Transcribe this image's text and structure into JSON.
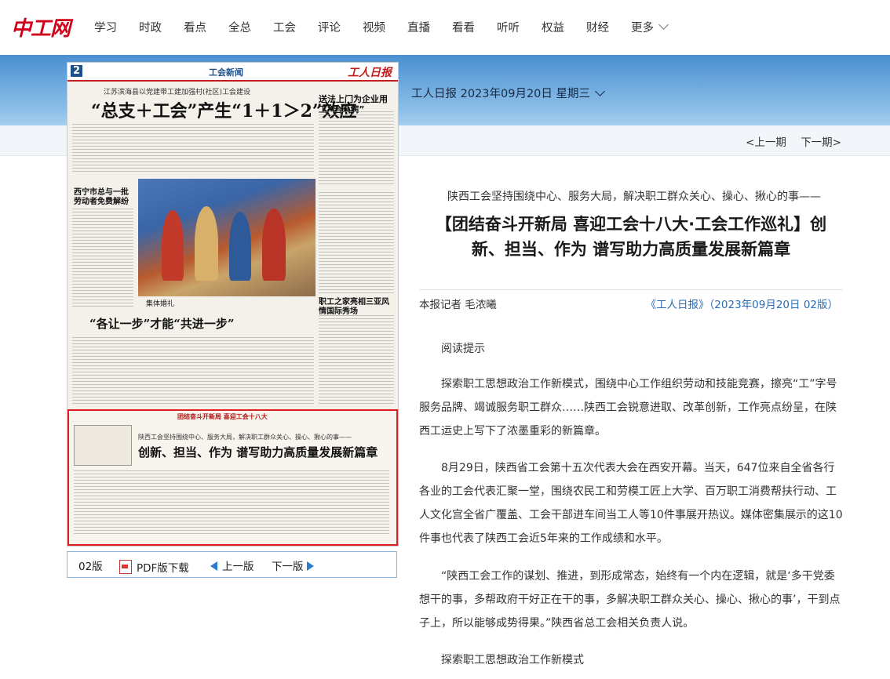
{
  "nav": {
    "logo": "中工网",
    "items": [
      "学习",
      "时政",
      "看点",
      "全总",
      "工会",
      "评论",
      "视频",
      "直播",
      "看看",
      "听听",
      "权益",
      "财经",
      "更多"
    ]
  },
  "edition": {
    "label": "工人日报 2023年09月20日 星期三"
  },
  "periods": {
    "prev": "<上一期",
    "next": "下一期>"
  },
  "paper": {
    "page_num": "2",
    "section": "工会新闻",
    "masthead": "工人日报",
    "sub1": "江苏滨海县以党建带工建加强村(社区)工会建设",
    "title1": "“总支＋工会”产生“1＋1＞2”效应",
    "side_head": "送法上门为企业用工“治未病”",
    "left_head": "西宁市总与一批劳动者免费解纷",
    "right_head2": "职工之家亮相三亚风情国际秀场",
    "photo_caption": "集体婚礼",
    "title2": "“各让一步”才能“共进一步”",
    "hl_banner": "团结奋斗开新局 喜迎工会十八大",
    "hl_kicker": "陕西工会坚持围绕中心、服务大局，解决职工群众关心、操心、揪心的事——",
    "hl_title": "创新、担当、作为 谱写助力高质量发展新篇章"
  },
  "pager": {
    "page": "02版",
    "pdf": "PDF版下载",
    "prev": "上一版",
    "next": "下一版"
  },
  "article": {
    "kicker": "陕西工会坚持围绕中心、服务大局，解决职工群众关心、操心、揪心的事——",
    "headline": "【团结奋斗开新局 喜迎工会十八大·工会工作巡礼】创新、担当、作为 谱写助力高质量发展新篇章",
    "byline": "本报记者 毛浓曦",
    "source": "《工人日报》（2023年09月20日 02版）",
    "paragraphs": [
      "阅读提示",
      "探索职工思想政治工作新模式，围绕中心工作组织劳动和技能竞赛，擦亮“工”字号服务品牌、竭诚服务职工群众……陕西工会锐意进取、改革创新，工作亮点纷呈，在陕西工运史上写下了浓墨重彩的新篇章。",
      "8月29日，陕西省工会第十五次代表大会在西安开幕。当天，647位来自全省各行各业的工会代表汇聚一堂，围绕农民工和劳模工匠上大学、百万职工消费帮扶行动、工人文化宫全省广覆盖、工会干部进车间当工人等10件事展开热议。媒体密集展示的这10件事也代表了陕西工会近5年来的工作成绩和水平。",
      "“陕西工会工作的谋划、推进，到形成常态，始终有一个内在逻辑，就是‘多干党委想干的事，多帮政府干好正在干的事，多解决职工群众关心、操心、揪心的事’，干到点子上，所以能够成势得果。”陕西省总工会相关负责人说。",
      "探索职工思想政治工作新模式"
    ]
  },
  "colors": {
    "brand": "#d0021b",
    "link": "#2a6db5",
    "highlight": "#e02020"
  }
}
